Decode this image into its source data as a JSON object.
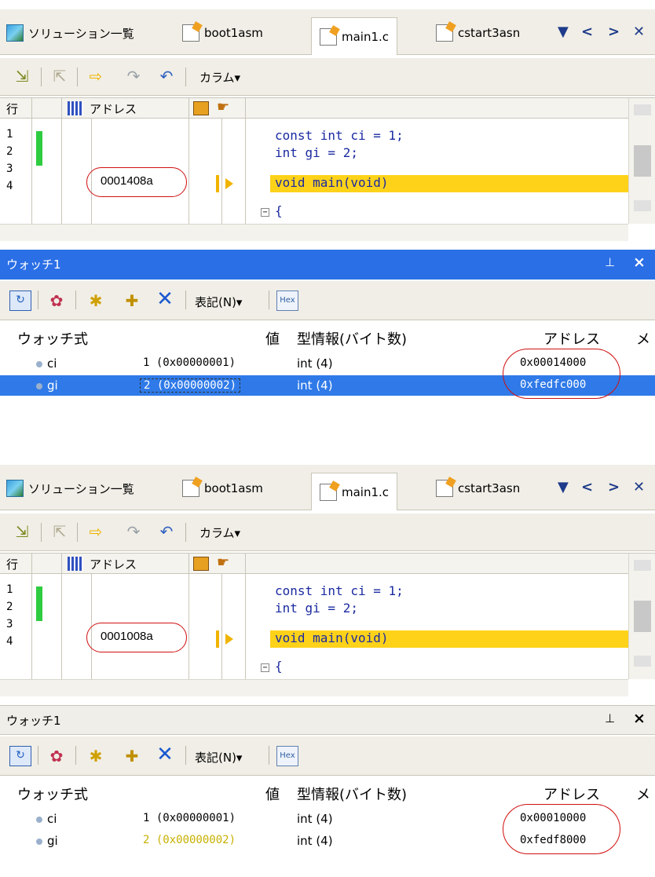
{
  "tabs": [
    "ソリューション一覧",
    "boot1asm",
    "main1.c",
    "cstart3asn"
  ],
  "tab_nav": [
    "▼",
    "<",
    ">",
    "✕"
  ],
  "editor_toolbar": {
    "column_menu": "カラム▾"
  },
  "editor_columns": {
    "row": "行",
    "address": "アドレス"
  },
  "line_numbers": [
    "1",
    "2",
    "3",
    "4"
  ],
  "code_lines": [
    "const int ci = 1;",
    "int gi = 2;",
    "void main(void)",
    "{"
  ],
  "watch_toolbar": {
    "notation_menu": "表記(N)▾",
    "hex": "Hex"
  },
  "watch_columns": {
    "expr": "ウォッチ式",
    "value": "値",
    "type": "型情報(バイト数)",
    "address": "アドレス",
    "memo": "メ"
  },
  "panels": [
    {
      "pc_address": "0001408a",
      "watch_title": "ウォッチ1",
      "rows": [
        {
          "name": "ci",
          "value": "1 (0x00000001)",
          "type": "int (4)",
          "address": "0x00014000"
        },
        {
          "name": "gi",
          "value": "2 (0x00000002)",
          "type": "int (4)",
          "address": "0xfedfc000"
        }
      ]
    },
    {
      "pc_address": "0001008a",
      "watch_title": "ウォッチ1",
      "rows": [
        {
          "name": "ci",
          "value": "1 (0x00000001)",
          "type": "int (4)",
          "address": "0x00010000"
        },
        {
          "name": "gi",
          "value": "2 (0x00000002)",
          "type": "int (4)",
          "address": "0xfedf8000"
        }
      ]
    }
  ],
  "colors": {
    "active_title": "#2a6fe6",
    "selection": "#2f7ae8",
    "pc_highlight": "#ffd21a",
    "annotation": "#d01010"
  }
}
